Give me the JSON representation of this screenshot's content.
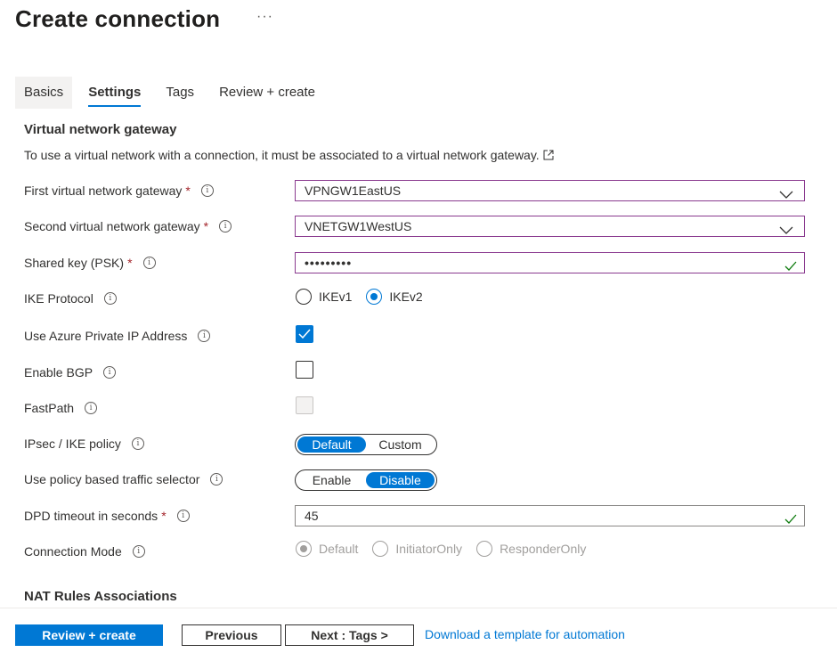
{
  "header": {
    "title": "Create connection",
    "more": "···"
  },
  "tabs": [
    {
      "label": "Basics"
    },
    {
      "label": "Settings"
    },
    {
      "label": "Tags"
    },
    {
      "label": "Review + create"
    }
  ],
  "section": {
    "title": "Virtual network gateway",
    "description": "To use a virtual network with a connection, it must be associated to a virtual network gateway."
  },
  "fields": {
    "first_gateway": {
      "label": "First virtual network gateway",
      "value": "VPNGW1EastUS"
    },
    "second_gateway": {
      "label": "Second virtual network gateway",
      "value": "VNETGW1WestUS"
    },
    "shared_key": {
      "label": "Shared key (PSK)",
      "value": "•••••••••"
    },
    "ike_protocol": {
      "label": "IKE Protocol",
      "options": [
        "IKEv1",
        "IKEv2"
      ],
      "selected": "IKEv2"
    },
    "private_ip": {
      "label": "Use Azure Private IP Address",
      "checked": true
    },
    "enable_bgp": {
      "label": "Enable BGP",
      "checked": false
    },
    "fastpath": {
      "label": "FastPath",
      "checked": false,
      "disabled": true
    },
    "ipsec_policy": {
      "label": "IPsec / IKE policy",
      "options": [
        "Default",
        "Custom"
      ],
      "selected": "Default"
    },
    "policy_selector": {
      "label": "Use policy based traffic selector",
      "options": [
        "Enable",
        "Disable"
      ],
      "selected": "Disable"
    },
    "dpd_timeout": {
      "label": "DPD timeout in seconds",
      "value": "45"
    },
    "connection_mode": {
      "label": "Connection Mode",
      "options": [
        "Default",
        "InitiatorOnly",
        "ResponderOnly"
      ],
      "selected": "Default",
      "disabled": true
    }
  },
  "nat": {
    "title": "NAT Rules Associations"
  },
  "footer": {
    "review_create": "Review + create",
    "previous": "Previous",
    "next": "Next : Tags >",
    "download": "Download a template for automation"
  },
  "colors": {
    "accent": "#0078d4",
    "required": "#a4262c",
    "valid": "#107c10",
    "focus_border": "#8a3a8f"
  }
}
